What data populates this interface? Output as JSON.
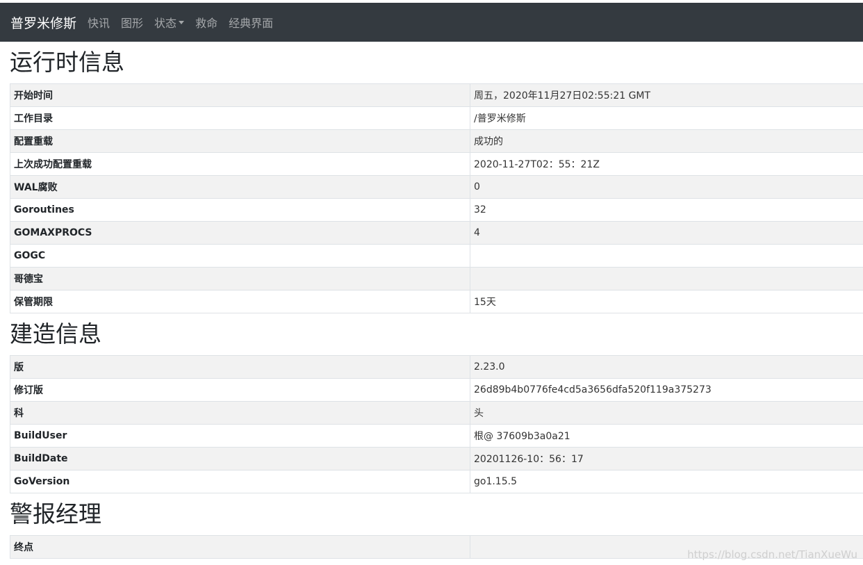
{
  "navbar": {
    "brand": "普罗米修斯",
    "links": [
      "快讯",
      "图形",
      "状态",
      "救命",
      "经典界面"
    ]
  },
  "runtime": {
    "title": "运行时信息",
    "rows": [
      {
        "key": "开始时间",
        "value": "周五，2020年11月27日02:55:21 GMT"
      },
      {
        "key": "工作目录",
        "value": "/普罗米修斯"
      },
      {
        "key": "配置重载",
        "value": "成功的"
      },
      {
        "key": "上次成功配置重载",
        "value": "2020-11-27T02：55：21Z"
      },
      {
        "key": "WAL腐败",
        "value": "0"
      },
      {
        "key": "Goroutines",
        "value": "32"
      },
      {
        "key": "GOMAXPROCS",
        "value": "4"
      },
      {
        "key": "GOGC",
        "value": ""
      },
      {
        "key": "哥德宝",
        "value": ""
      },
      {
        "key": "保管期限",
        "value": "15天"
      }
    ]
  },
  "build": {
    "title": "建造信息",
    "rows": [
      {
        "key": "版",
        "value": "2.23.0"
      },
      {
        "key": "修订版",
        "value": "26d89b4b0776fe4cd5a3656dfa520f119a375273"
      },
      {
        "key": "科",
        "value": "头"
      },
      {
        "key": "BuildUser",
        "value": "根@ 37609b3a0a21"
      },
      {
        "key": "BuildDate",
        "value": "20201126-10：56：17"
      },
      {
        "key": "GoVersion",
        "value": "go1.15.5"
      }
    ]
  },
  "alertmanager": {
    "title": "警报经理",
    "rows": [
      {
        "key": "终点",
        "value": ""
      }
    ]
  },
  "watermark": "https://blog.csdn.net/TianXueWu"
}
